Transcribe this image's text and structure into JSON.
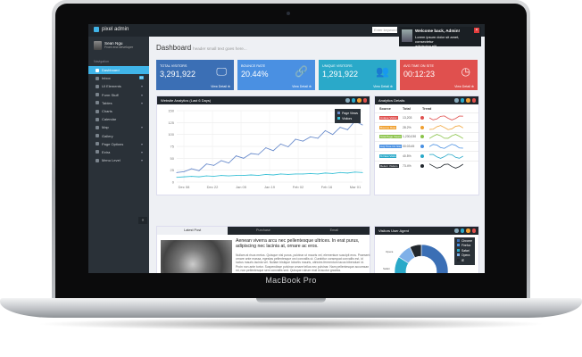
{
  "device_label": "MacBook Pro",
  "app": {
    "name": "pixel admin",
    "search_placeholder": "Enter keyword"
  },
  "notification": {
    "title": "Welcome back, Admin!",
    "line1": "Lorem ipsum dolor sit amet, consectetur",
    "line2": "adipiscing elit"
  },
  "user": {
    "name": "Sean Ngu",
    "role": "Front end developer"
  },
  "sidebar": {
    "label": "Navigation",
    "items": [
      {
        "label": "Dashboard",
        "active": true
      },
      {
        "label": "Inbox",
        "badge": "10"
      },
      {
        "label": "UI Elements",
        "caret": true
      },
      {
        "label": "Form Stuff",
        "caret": true
      },
      {
        "label": "Tables",
        "caret": true
      },
      {
        "label": "Charts"
      },
      {
        "label": "Calendar"
      },
      {
        "label": "Map",
        "caret": true
      },
      {
        "label": "Gallery"
      },
      {
        "label": "Page Options",
        "caret": true
      },
      {
        "label": "Extra",
        "caret": true
      },
      {
        "label": "Menu Level",
        "caret": true
      }
    ]
  },
  "header": {
    "title": "Dashboard",
    "subtitle": "header small text goes here..."
  },
  "stats": [
    {
      "label": "TOTAL VISITORS",
      "value": "3,291,922",
      "link": "View Detail",
      "color": "#3b6fb5",
      "icon": "monitor-icon"
    },
    {
      "label": "BOUNCE RATE",
      "value": "20.44%",
      "link": "View Detail",
      "color": "#4a90e2",
      "icon": "link-icon"
    },
    {
      "label": "UNIQUE VISITORS",
      "value": "1,291,922",
      "link": "View Detail",
      "color": "#2aa9c9",
      "icon": "users-icon"
    },
    {
      "label": "AVG TIME ON SITE",
      "value": "00:12:23",
      "link": "View Detail",
      "color": "#e0504e",
      "icon": "clock-icon"
    }
  ],
  "analytics_panel": {
    "title": "Website Analytics (Last 6 Days)"
  },
  "chart_data": {
    "type": "line",
    "title": "Website Analytics (Last 6 Days)",
    "x": [
      "Dec 08",
      "Dec 22",
      "Jan 05",
      "Jan 19",
      "Feb 02",
      "Feb 16",
      "Mar 01"
    ],
    "ylim": [
      0,
      150
    ],
    "yticks": [
      0,
      25,
      50,
      75,
      100,
      125,
      150
    ],
    "series": [
      {
        "name": "Page Views",
        "color": "#6a8ccc",
        "values": [
          20,
          22,
          28,
          24,
          38,
          35,
          45,
          40,
          55,
          50,
          60,
          58,
          72,
          66,
          80,
          74,
          90,
          86,
          95,
          92,
          108,
          100,
          115,
          110,
          128,
          120
        ]
      },
      {
        "name": "Visitors",
        "color": "#3ac0d6",
        "values": [
          10,
          11,
          12,
          11,
          13,
          12,
          14,
          13,
          14,
          14,
          15,
          14,
          16,
          15,
          17,
          16,
          17,
          17,
          18,
          17,
          19,
          18,
          20,
          19,
          21,
          20
        ]
      }
    ],
    "legend": "top-right"
  },
  "analytics_details": {
    "title": "Analytics Details",
    "headers": [
      "Source",
      "Total",
      "Trend"
    ],
    "rows": [
      {
        "source": "Unique Visitor",
        "total": "13,203",
        "color": "#e0504e"
      },
      {
        "source": "Bounce Rate",
        "total": "28.2%",
        "color": "#f0a030"
      },
      {
        "source": "Total Page Views",
        "total": "1,230,030",
        "color": "#8bc34a"
      },
      {
        "source": "Avg Time On Site",
        "total": "00:03:45",
        "color": "#4a90e2"
      },
      {
        "source": "% New Visits",
        "total": "40.5%",
        "color": "#2aa9c9"
      },
      {
        "source": "Return Visitors",
        "total": "73.4%",
        "color": "#20262c"
      }
    ]
  },
  "post_panel": {
    "tabs": [
      "Latest Post",
      "Purchase",
      "Email"
    ],
    "title": "Aenean viverra arcu nec pellentesque ultrices. In erat purus, adipiscing nec lacinia at, ornare ac eros.",
    "body": "Nullam at risus metus. Quisque nisl purus, pulvinar ut mauris vel, elementum suscipit eros. Praesent ornare ante massa, egestas pellentesque orci convallis ut. Curabitur consequat convallis est, id luctus mauris lacinia vel. Nullam tristique lobortis mauris, ultricies fermentum lacus bibendum id. Proin non ante tortor. Suspendisse pulvinar ornare tellus nec pulvinar. Nam pellentesque accumsan mi, non pellentesque sem convallis sed. Quisque rutrum erat id auctor gravida."
  },
  "visitor_agent": {
    "title": "Visitors User Agent",
    "legend": [
      {
        "name": "Chrome",
        "color": "#3b6fb5"
      },
      {
        "name": "Firefox",
        "color": "#4a90e2"
      },
      {
        "name": "Safari",
        "color": "#2aa9c9"
      },
      {
        "name": "Opera",
        "color": "#7fb0e8"
      },
      {
        "name": "IE",
        "color": "#20262c"
      }
    ],
    "slices": [
      {
        "label": "Chrome",
        "value": 52
      },
      {
        "label": "Firefox",
        "value": 18
      },
      {
        "label": "Safari",
        "value": 14
      },
      {
        "label": "Opera",
        "value": 9
      },
      {
        "label": "IE",
        "value": 7
      }
    ],
    "labels": [
      "Safari",
      "Opera"
    ]
  }
}
